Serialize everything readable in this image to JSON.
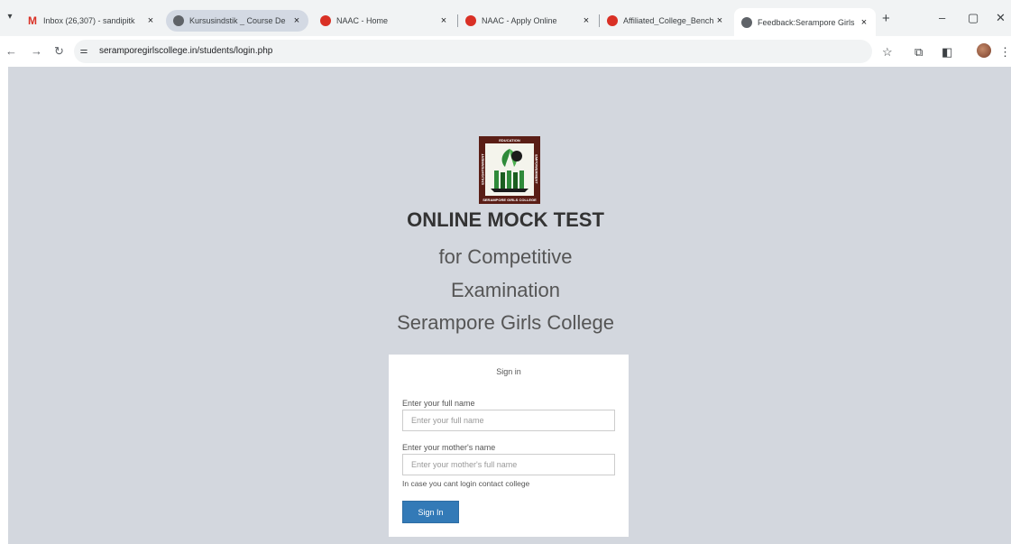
{
  "browser": {
    "tabs": [
      {
        "title": "Inbox (26,307) - sandipitk",
        "icon": "gmail-icon"
      },
      {
        "title": "Kursusindstik _ Course De",
        "icon": "globe-icon"
      },
      {
        "title": "NAAC - Home",
        "icon": "naac-icon"
      },
      {
        "title": "NAAC - Apply Online",
        "icon": "naac-icon"
      },
      {
        "title": "Affiliated_College_Benchm",
        "icon": "naac-icon"
      },
      {
        "title": "Feedback:Serampore Girls",
        "icon": "globe-icon"
      }
    ],
    "close_glyph": "×",
    "new_tab_glyph": "+",
    "url": "seramporegirlscollege.in/students/login.php"
  },
  "logo": {
    "top_text": "EDUCATION",
    "bottom_text": "SERAMPORE GIRLS COLLEGE",
    "left_text": "ENLIGHTENMENT",
    "right_text": "EMPOWERMENT"
  },
  "header": {
    "title": "ONLINE MOCK TEST",
    "line2": "for Competitive",
    "line3": "Examination",
    "line4": "Serampore Girls College"
  },
  "form": {
    "title": "Sign in",
    "name_label": "Enter your full name",
    "name_placeholder": "Enter your full name",
    "mother_label": "Enter your mother's name",
    "mother_placeholder": "Enter your mother's full name",
    "help_text": "In case you cant login contact college",
    "submit_label": "Sign In"
  },
  "colors": {
    "page_bg": "#d3d7de",
    "button": "#337ab7",
    "logo_frame": "#5a1e16"
  }
}
